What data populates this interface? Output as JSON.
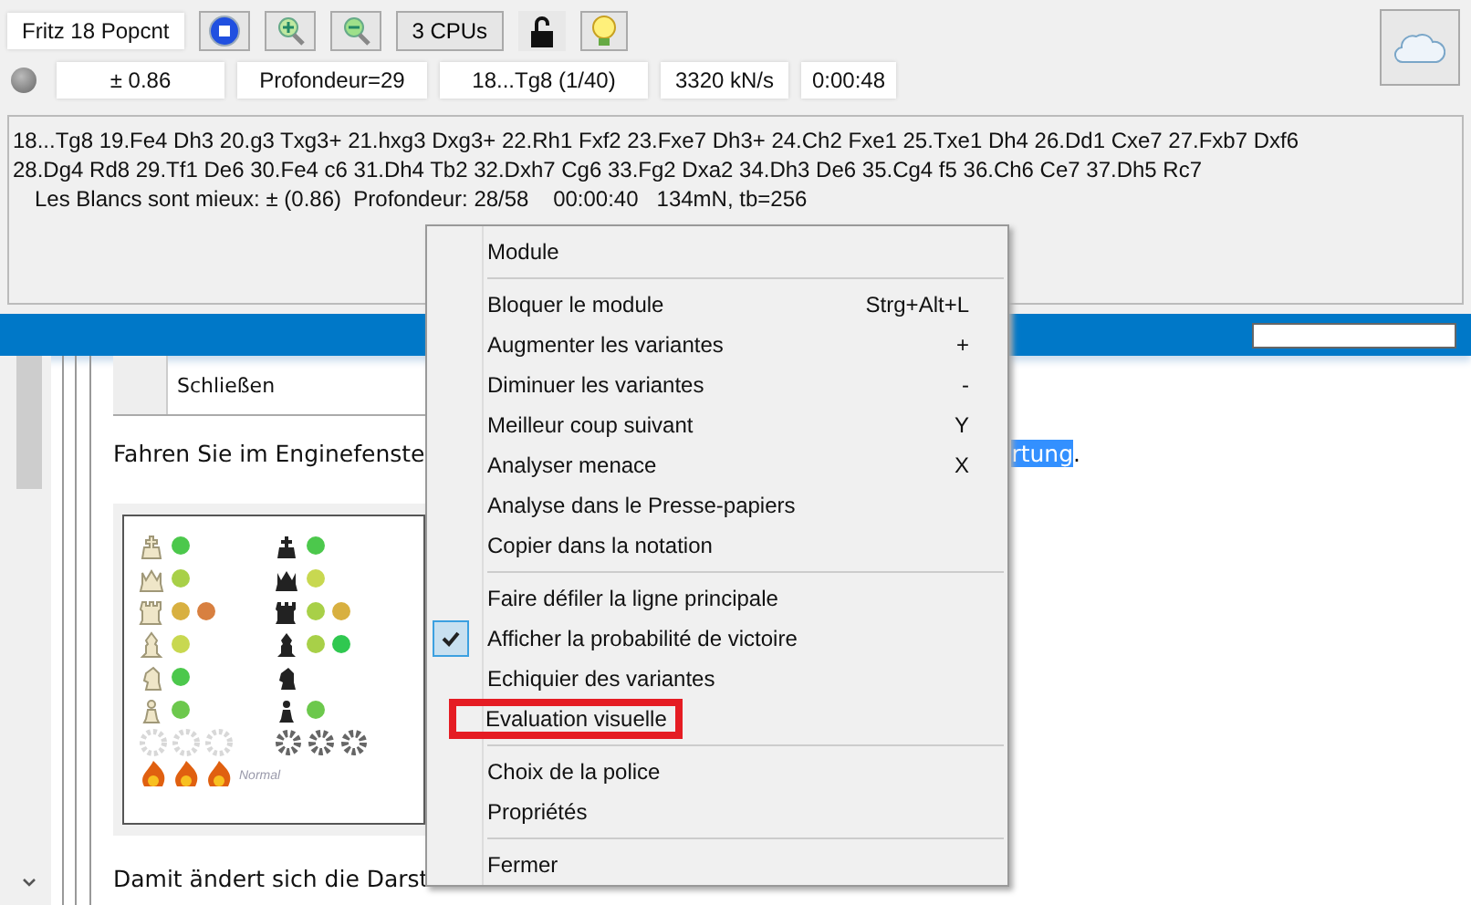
{
  "engine": {
    "name": "Fritz 18 Popcnt",
    "cpus": "3 CPUs",
    "locked": false
  },
  "stats": [
    "± 0.86",
    "Profondeur=29",
    "18...Tg8 (1/40)",
    "3320 kN/s",
    "0:00:48"
  ],
  "analysis": {
    "lines": [
      "18...Tg8 19.Fe4 Dh3 20.g3 Txg3+ 21.hxg3 Dxg3+ 22.Rh1 Fxf2 23.Fxe7 Dh3+ 24.Ch2 Fxe1 25.Txe1 Dh4 26.Dd1 Cxe7 27.Fxb7 Dxf6",
      "28.Dg4 Rd8 29.Tf1 De6 30.Fe4 c6 31.Dh4 Tb2 32.Dxh7 Cg6 33.Fg2 Dxa2 34.Dh3 De6 35.Cg4 f5 36.Ch6 Ce7 37.Dh5 Rc7"
    ],
    "summary": "Les Blancs sont mieux: ± (0.86)  Profondeur: 28/58    00:00:40   134mN, tb=256"
  },
  "help": {
    "table_cell": "Schließen",
    "para_start": "Fahren Sie im Enginefenste",
    "para_link": "rtung",
    "para_end": ".",
    "bottom": "Damit ändert sich die Darst",
    "legend": {
      "rows": [
        {
          "kind": "king",
          "white": [
            {
              "color": "#4cc84c"
            }
          ],
          "black": [
            {
              "color": "#4cc84c"
            }
          ]
        },
        {
          "kind": "queen",
          "white": [
            {
              "color": "#a8d048"
            }
          ],
          "black": [
            {
              "color": "#c8d850"
            }
          ]
        },
        {
          "kind": "rook",
          "white": [
            {
              "color": "#d8b040"
            },
            {
              "color": "#d88040"
            }
          ],
          "black": [
            {
              "color": "#a8d048"
            },
            {
              "color": "#d8b040"
            }
          ]
        },
        {
          "kind": "bishop",
          "white": [
            {
              "color": "#c8d850"
            }
          ],
          "black": [
            {
              "color": "#a8d048"
            },
            {
              "color": "#30c850"
            }
          ]
        },
        {
          "kind": "knight",
          "white": [
            {
              "color": "#4cc84c"
            }
          ]
        },
        {
          "kind": "pawn",
          "white": [
            {
              "color": "#6cc84c"
            }
          ],
          "black": [
            {
              "color": "#6cc84c"
            }
          ]
        }
      ],
      "label": "Normal"
    }
  },
  "menu": [
    {
      "kind": "item",
      "label": "Module",
      "checked": false,
      "marked": false
    },
    {
      "kind": "separator"
    },
    {
      "kind": "item",
      "label": "Bloquer le module",
      "shortcut": "Strg+Alt+L",
      "checked": false,
      "marked": false
    },
    {
      "kind": "item",
      "label": "Augmenter les variantes",
      "shortcut": "+",
      "checked": false,
      "marked": false
    },
    {
      "kind": "item",
      "label": "Diminuer les variantes",
      "shortcut": "-",
      "checked": false,
      "marked": false
    },
    {
      "kind": "item",
      "label": "Meilleur coup suivant",
      "shortcut": "Y",
      "checked": false,
      "marked": false
    },
    {
      "kind": "item",
      "label": "Analyser menace",
      "shortcut": "X",
      "checked": false,
      "marked": false
    },
    {
      "kind": "item",
      "label": "Analyse dans le Presse-papiers",
      "checked": false,
      "marked": false
    },
    {
      "kind": "item",
      "label": "Copier dans la notation",
      "checked": false,
      "marked": false
    },
    {
      "kind": "separator"
    },
    {
      "kind": "item",
      "label": "Faire défiler la ligne principale",
      "checked": false,
      "marked": false
    },
    {
      "kind": "item",
      "label": "Afficher la probabilité de victoire",
      "checked": true,
      "marked": false
    },
    {
      "kind": "item",
      "label": "Echiquier des variantes",
      "checked": false,
      "marked": false
    },
    {
      "kind": "item",
      "label": "Evaluation visuelle",
      "checked": false,
      "marked": true
    },
    {
      "kind": "separator"
    },
    {
      "kind": "item",
      "label": "Choix de la police",
      "checked": false,
      "marked": false
    },
    {
      "kind": "item",
      "label": "Propriétés",
      "checked": false,
      "marked": false
    },
    {
      "kind": "separator"
    },
    {
      "kind": "item",
      "label": "Fermer",
      "checked": false,
      "marked": false
    }
  ]
}
